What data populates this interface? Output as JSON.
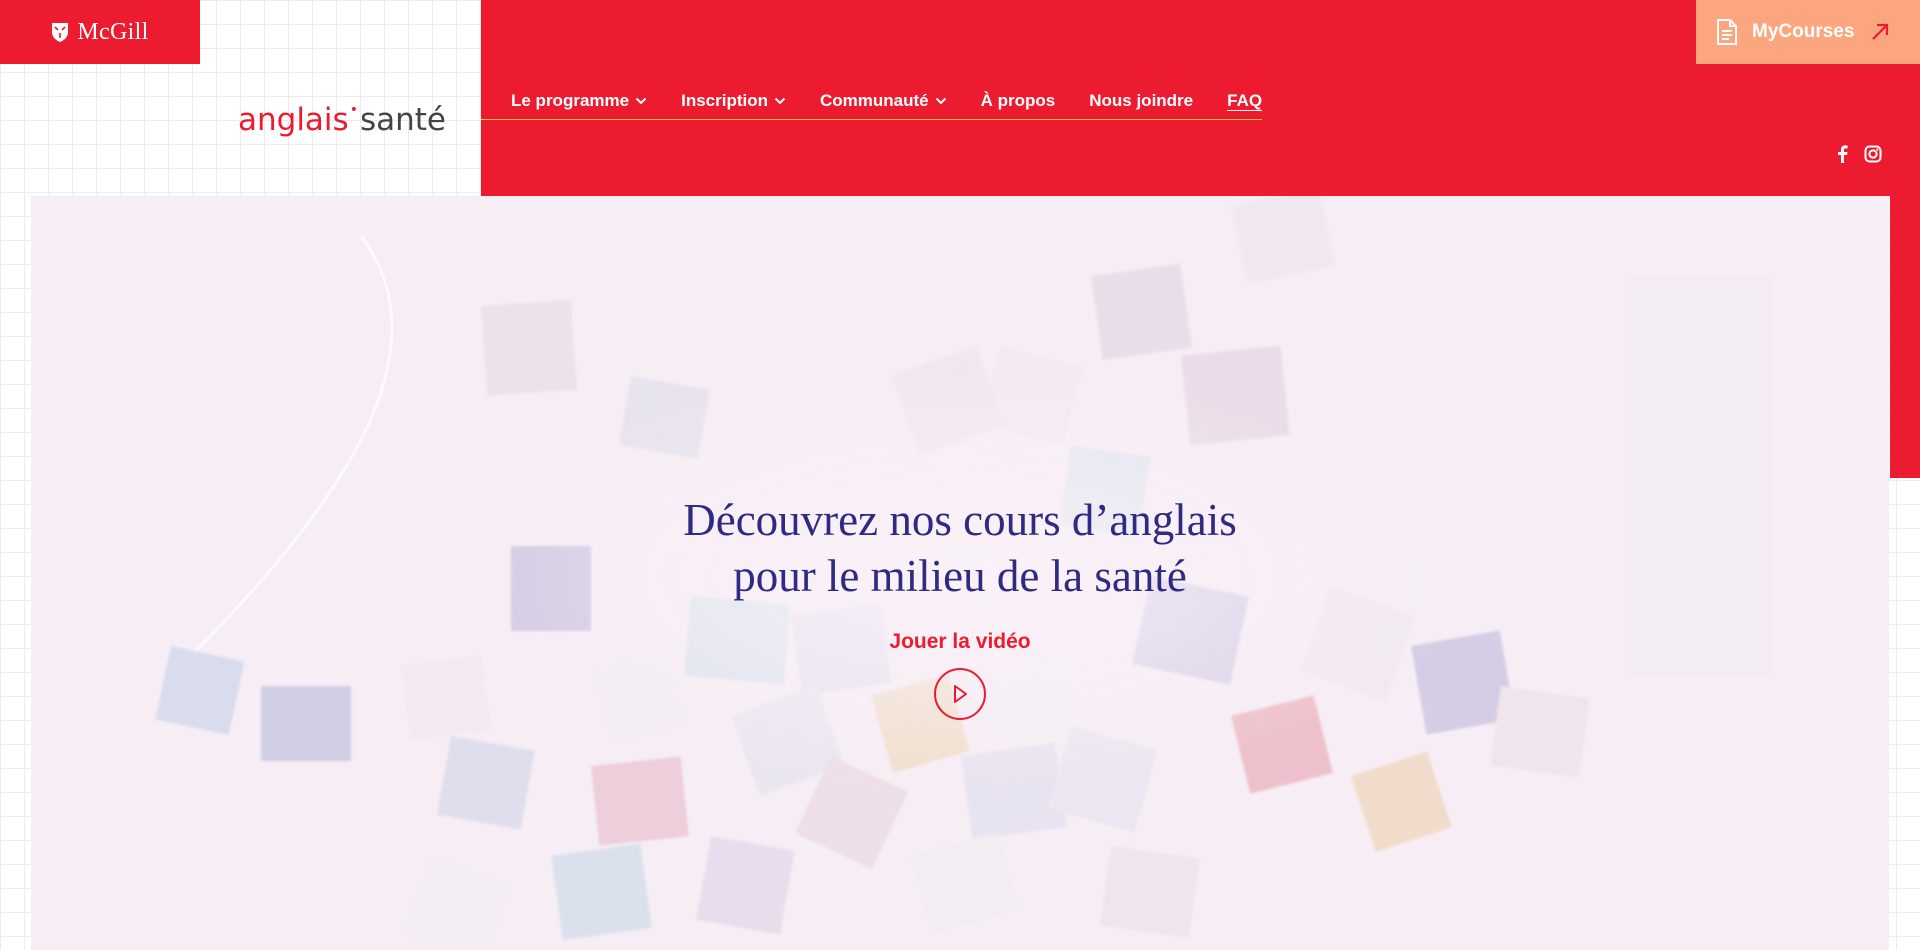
{
  "brand": {
    "university": "McGill",
    "logo_word_1": "anglais",
    "logo_dot": "•",
    "logo_word_2": "santé"
  },
  "nav": {
    "items": [
      {
        "label": "Le programme",
        "has_dropdown": true
      },
      {
        "label": "Inscription",
        "has_dropdown": true
      },
      {
        "label": "Communauté",
        "has_dropdown": true
      },
      {
        "label": "À propos",
        "has_dropdown": false
      },
      {
        "label": "Nous joindre",
        "has_dropdown": false
      },
      {
        "label": "FAQ",
        "has_dropdown": false
      }
    ]
  },
  "mycourses": {
    "label": "MyCourses",
    "icon": "document-icon",
    "arrow_icon": "external-arrow-icon"
  },
  "social": {
    "icons": [
      "facebook-icon",
      "instagram-icon"
    ]
  },
  "hero": {
    "title_line_1": "Découvrez nos cours d’anglais",
    "title_line_2": "pour le milieu de la santé",
    "play_label": "Jouer la vidéo",
    "play_icon": "play-icon"
  },
  "colors": {
    "accent_red": "#ed1b2f",
    "mycourses_orange": "#fba67e",
    "title_navy": "#2f2a82",
    "nav_underline": "#f6c542"
  }
}
